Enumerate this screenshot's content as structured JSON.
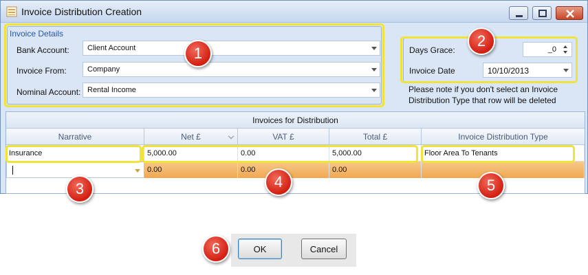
{
  "window": {
    "title": "Invoice Distribution Creation"
  },
  "invoice_details": {
    "group_title": "Invoice Details",
    "bank_account": {
      "label": "Bank Account:",
      "value": "Client Account"
    },
    "invoice_from": {
      "label": "Invoice From:",
      "value": "Company"
    },
    "nominal_account": {
      "label": "Nominal Account:",
      "value": "Rental Income"
    }
  },
  "right_panel": {
    "days_grace": {
      "label": "Days Grace:",
      "value": "_0"
    },
    "invoice_date": {
      "label": "Invoice Date",
      "value": "10/10/2013"
    },
    "note_line1": "Please note if you don't select an Invoice",
    "note_line2": "Distribution Type that row will be deleted"
  },
  "grid": {
    "caption": "Invoices for Distribution",
    "columns": [
      "Narrative",
      "Net £",
      "VAT £",
      "Total £",
      "Invoice Distribution Type"
    ],
    "rows": [
      [
        "Insurance",
        "5,000.00",
        "0.00",
        "5,000.00",
        "Floor Area To Tenants"
      ],
      [
        "",
        "0.00",
        "0.00",
        "0.00",
        ""
      ]
    ]
  },
  "markers": [
    "1",
    "2",
    "3",
    "4",
    "5",
    "6"
  ],
  "buttons": {
    "ok": "OK",
    "cancel": "Cancel"
  },
  "colors": {
    "highlight": "#f2e33a",
    "marker": "#d21f12",
    "active_row": "#f0a850"
  }
}
